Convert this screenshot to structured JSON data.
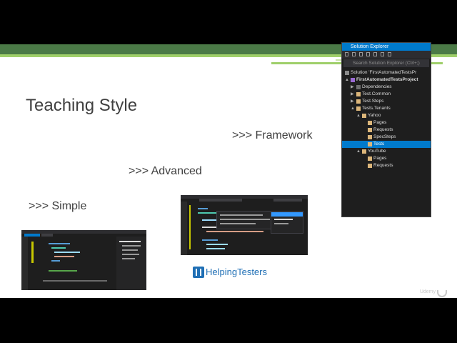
{
  "slide": {
    "title": "Teaching Style",
    "bullets": {
      "framework": ">>> Framework",
      "advanced": ">>> Advanced",
      "simple": ">>> Simple"
    }
  },
  "solution_explorer": {
    "title": "Solution Explorer",
    "search_placeholder": "Search Solution Explorer (Ctrl+;)",
    "items": [
      {
        "label": "Solution 'FirstAutomatedTestsPr"
      },
      {
        "label": "FirstAutomatedTestsProject"
      },
      {
        "label": "Dependencies"
      },
      {
        "label": "Test.Common"
      },
      {
        "label": "Test.Steps"
      },
      {
        "label": "Tests.Tenants"
      },
      {
        "label": "Yahoo"
      },
      {
        "label": "Pages"
      },
      {
        "label": "Requests"
      },
      {
        "label": "SpecSteps"
      },
      {
        "label": "Tests"
      },
      {
        "label": "YouTube"
      },
      {
        "label": "Pages"
      },
      {
        "label": "Requests"
      }
    ]
  },
  "logo": {
    "text": "HelpingTesters"
  },
  "watermark": {
    "text": "Udemy"
  },
  "colors": {
    "slide_band_dark": "#4b7a47",
    "slide_band_light": "#9fcf6a",
    "vs_accent": "#007acc",
    "vs_background": "#1e1e1e",
    "logo_blue": "#1f6fb5"
  }
}
